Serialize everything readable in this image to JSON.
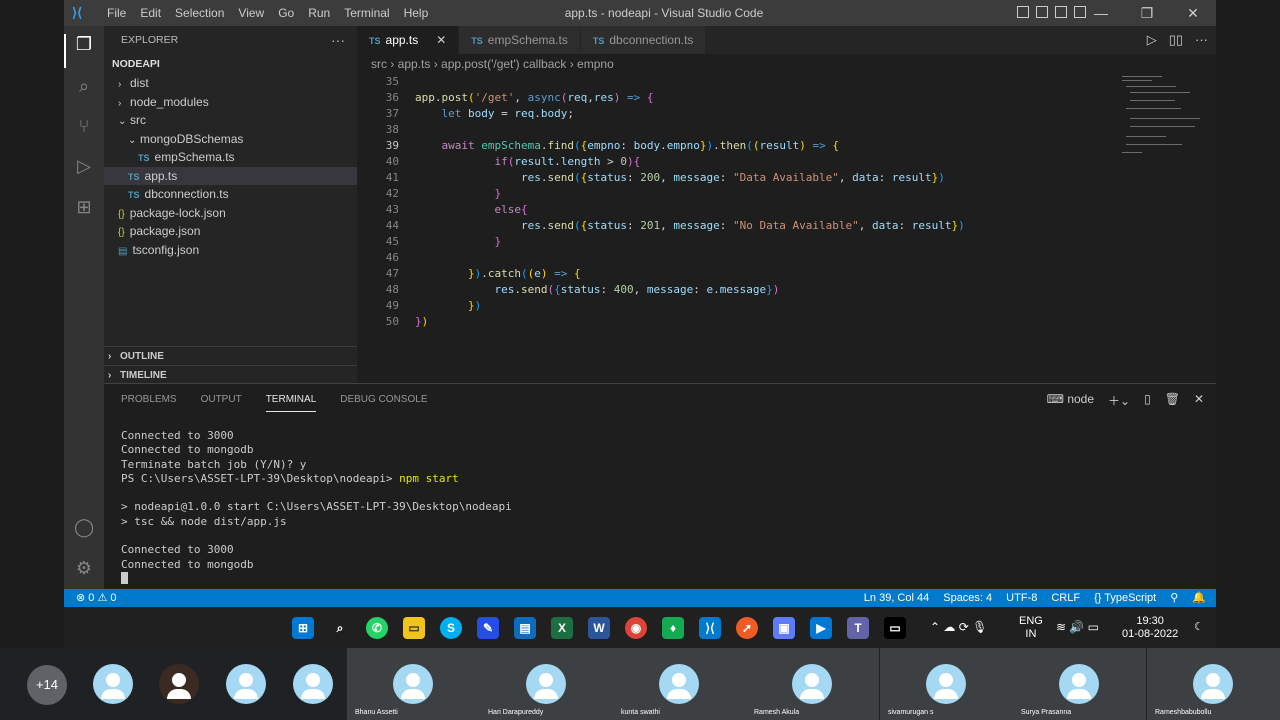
{
  "window": {
    "title": "app.ts - nodeapi - Visual Studio Code",
    "menu": [
      "File",
      "Edit",
      "Selection",
      "View",
      "Go",
      "Run",
      "Terminal",
      "Help"
    ]
  },
  "sidebar": {
    "title": "EXPLORER",
    "project": "NODEAPI",
    "tree": [
      {
        "label": "dist",
        "kind": "folder",
        "icon": "",
        "depth": 0,
        "open": false
      },
      {
        "label": "node_modules",
        "kind": "folder",
        "icon": "",
        "depth": 0,
        "open": false
      },
      {
        "label": "src",
        "kind": "folder",
        "icon": "",
        "depth": 0,
        "open": true
      },
      {
        "label": "mongoDBSchemas",
        "kind": "folder",
        "icon": "",
        "depth": 1,
        "open": true
      },
      {
        "label": "empSchema.ts",
        "kind": "ts",
        "icon": "TS",
        "depth": 2
      },
      {
        "label": "app.ts",
        "kind": "ts",
        "icon": "TS",
        "depth": 1,
        "selected": true
      },
      {
        "label": "dbconnection.ts",
        "kind": "ts",
        "icon": "TS",
        "depth": 1
      },
      {
        "label": "package-lock.json",
        "kind": "json",
        "icon": "{}",
        "depth": 0
      },
      {
        "label": "package.json",
        "kind": "json",
        "icon": "{}",
        "depth": 0
      },
      {
        "label": "tsconfig.json",
        "kind": "cfg",
        "icon": "▤",
        "depth": 0
      }
    ],
    "outline": "OUTLINE",
    "timeline": "TIMELINE"
  },
  "tabs": [
    {
      "label": "app.ts",
      "active": true
    },
    {
      "label": "empSchema.ts",
      "active": false
    },
    {
      "label": "dbconnection.ts",
      "active": false
    }
  ],
  "breadcrumb": [
    "src",
    "app.ts",
    "app.post('/get') callback",
    "empno"
  ],
  "code": [
    {
      "n": "35",
      "tokens": []
    },
    {
      "n": "36",
      "tokens": [
        [
          "fn",
          "app"
        ],
        [
          "pun",
          "."
        ],
        [
          "fn",
          "post"
        ],
        [
          "b1",
          "("
        ],
        [
          "str",
          "'/get'"
        ],
        [
          "pun",
          ", "
        ],
        [
          "kw",
          "async"
        ],
        [
          "b2",
          "("
        ],
        [
          "var",
          "req"
        ],
        [
          "pun",
          ","
        ],
        [
          "var",
          "res"
        ],
        [
          "b2",
          ")"
        ],
        [
          "kw",
          " =>"
        ],
        [
          "pun",
          " "
        ],
        [
          "b2",
          "{"
        ]
      ]
    },
    {
      "n": "37",
      "tokens": [
        [
          "pun",
          "    "
        ],
        [
          "kw",
          "let"
        ],
        [
          "pun",
          " "
        ],
        [
          "var",
          "body"
        ],
        [
          "pun",
          " = "
        ],
        [
          "var",
          "req"
        ],
        [
          "pun",
          "."
        ],
        [
          "var",
          "body"
        ],
        [
          "pun",
          ";"
        ]
      ]
    },
    {
      "n": "38",
      "tokens": []
    },
    {
      "n": "39",
      "tokens": [
        [
          "pun",
          "    "
        ],
        [
          "kc",
          "await"
        ],
        [
          "pun",
          " "
        ],
        [
          "typ",
          "empSchema"
        ],
        [
          "pun",
          "."
        ],
        [
          "fn",
          "find"
        ],
        [
          "b3",
          "("
        ],
        [
          "b1",
          "{"
        ],
        [
          "var",
          "empno"
        ],
        [
          "pun",
          ": "
        ],
        [
          "var",
          "body"
        ],
        [
          "pun",
          "."
        ],
        [
          "var",
          "empno"
        ],
        [
          "b1",
          "}"
        ],
        [
          "b3",
          ")"
        ],
        [
          "pun",
          "."
        ],
        [
          "fn",
          "then"
        ],
        [
          "b3",
          "("
        ],
        [
          "b1",
          "("
        ],
        [
          "var",
          "result"
        ],
        [
          "b1",
          ")"
        ],
        [
          "kw",
          " =>"
        ],
        [
          "pun",
          " "
        ],
        [
          "b1",
          "{"
        ]
      ]
    },
    {
      "n": "40",
      "tokens": [
        [
          "pun",
          "            "
        ],
        [
          "kc",
          "if"
        ],
        [
          "b2",
          "("
        ],
        [
          "var",
          "result"
        ],
        [
          "pun",
          "."
        ],
        [
          "var",
          "length"
        ],
        [
          "pun",
          " > "
        ],
        [
          "num",
          "0"
        ],
        [
          "b2",
          ")"
        ],
        [
          "b2",
          "{"
        ]
      ]
    },
    {
      "n": "41",
      "tokens": [
        [
          "pun",
          "                "
        ],
        [
          "var",
          "res"
        ],
        [
          "pun",
          "."
        ],
        [
          "fn",
          "send"
        ],
        [
          "b3",
          "("
        ],
        [
          "b1",
          "{"
        ],
        [
          "var",
          "status"
        ],
        [
          "pun",
          ": "
        ],
        [
          "num",
          "200"
        ],
        [
          "pun",
          ", "
        ],
        [
          "var",
          "message"
        ],
        [
          "pun",
          ": "
        ],
        [
          "str",
          "\"Data Available\""
        ],
        [
          "pun",
          ", "
        ],
        [
          "var",
          "data"
        ],
        [
          "pun",
          ": "
        ],
        [
          "var",
          "result"
        ],
        [
          "b1",
          "}"
        ],
        [
          "b3",
          ")"
        ]
      ]
    },
    {
      "n": "42",
      "tokens": [
        [
          "pun",
          "            "
        ],
        [
          "b2",
          "}"
        ]
      ]
    },
    {
      "n": "43",
      "tokens": [
        [
          "pun",
          "            "
        ],
        [
          "kc",
          "else"
        ],
        [
          "b2",
          "{"
        ]
      ]
    },
    {
      "n": "44",
      "tokens": [
        [
          "pun",
          "                "
        ],
        [
          "var",
          "res"
        ],
        [
          "pun",
          "."
        ],
        [
          "fn",
          "send"
        ],
        [
          "b3",
          "("
        ],
        [
          "b1",
          "{"
        ],
        [
          "var",
          "status"
        ],
        [
          "pun",
          ": "
        ],
        [
          "num",
          "201"
        ],
        [
          "pun",
          ", "
        ],
        [
          "var",
          "message"
        ],
        [
          "pun",
          ": "
        ],
        [
          "str",
          "\"No Data Available\""
        ],
        [
          "pun",
          ", "
        ],
        [
          "var",
          "data"
        ],
        [
          "pun",
          ": "
        ],
        [
          "var",
          "result"
        ],
        [
          "b1",
          "}"
        ],
        [
          "b3",
          ")"
        ]
      ]
    },
    {
      "n": "45",
      "tokens": [
        [
          "pun",
          "            "
        ],
        [
          "b2",
          "}"
        ]
      ]
    },
    {
      "n": "46",
      "tokens": []
    },
    {
      "n": "47",
      "tokens": [
        [
          "pun",
          "        "
        ],
        [
          "b1",
          "}"
        ],
        [
          "b3",
          ")"
        ],
        [
          "pun",
          "."
        ],
        [
          "fn",
          "catch"
        ],
        [
          "b3",
          "("
        ],
        [
          "b1",
          "("
        ],
        [
          "var",
          "e"
        ],
        [
          "b1",
          ")"
        ],
        [
          "kw",
          " =>"
        ],
        [
          "pun",
          " "
        ],
        [
          "b1",
          "{"
        ]
      ]
    },
    {
      "n": "48",
      "tokens": [
        [
          "pun",
          "            "
        ],
        [
          "var",
          "res"
        ],
        [
          "pun",
          "."
        ],
        [
          "fn",
          "send"
        ],
        [
          "b2",
          "("
        ],
        [
          "b3",
          "{"
        ],
        [
          "var",
          "status"
        ],
        [
          "pun",
          ": "
        ],
        [
          "num",
          "400"
        ],
        [
          "pun",
          ", "
        ],
        [
          "var",
          "message"
        ],
        [
          "pun",
          ": "
        ],
        [
          "var",
          "e"
        ],
        [
          "pun",
          "."
        ],
        [
          "var",
          "message"
        ],
        [
          "b3",
          "}"
        ],
        [
          "b2",
          ")"
        ]
      ]
    },
    {
      "n": "49",
      "tokens": [
        [
          "pun",
          "        "
        ],
        [
          "b1",
          "}"
        ],
        [
          "b3",
          ")"
        ]
      ]
    },
    {
      "n": "50",
      "tokens": [
        [
          "b2",
          "}"
        ],
        [
          "b1",
          ")"
        ]
      ]
    }
  ],
  "panel": {
    "tabs": [
      "PROBLEMS",
      "OUTPUT",
      "TERMINAL",
      "DEBUG CONSOLE"
    ],
    "active": "TERMINAL",
    "terminal_name": "node",
    "lines": [
      {
        "text": "Connected to 3000"
      },
      {
        "text": "Connected to mongodb"
      },
      {
        "text": "Terminate batch job (Y/N)? y"
      },
      {
        "text": "PS C:\\Users\\ASSET-LPT-39\\Desktop\\nodeapi> ",
        "cmd": "npm start"
      },
      {
        "text": ""
      },
      {
        "text": "> nodeapi@1.0.0 start C:\\Users\\ASSET-LPT-39\\Desktop\\nodeapi"
      },
      {
        "text": "> tsc && node dist/app.js"
      },
      {
        "text": ""
      },
      {
        "text": "Connected to 3000"
      },
      {
        "text": "Connected to mongodb"
      }
    ]
  },
  "status": {
    "problems": "⊗ 0 ⚠ 0",
    "position": "Ln 39, Col 44",
    "spaces": "Spaces: 4",
    "encoding": "UTF-8",
    "eol": "CRLF",
    "language": "{} TypeScript"
  },
  "taskbar": {
    "language": "ENG",
    "region": "IN",
    "time": "19:30",
    "date": "01-08-2022"
  },
  "meeting": {
    "more_count": "+14",
    "participants": [
      "",
      "",
      "",
      "",
      "Bhanu Assetti",
      "Hari Darapureddy",
      "kunta swathi",
      "Ramesh Akula",
      "sivamurugan s",
      "Surya Prasanna",
      "Rameshbabubollu"
    ]
  }
}
